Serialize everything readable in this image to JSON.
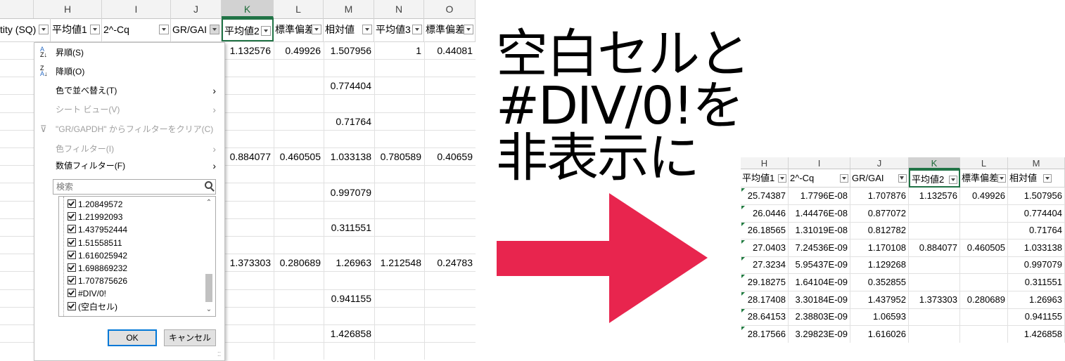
{
  "left_sheet": {
    "columns": [
      "H",
      "I",
      "J",
      "K",
      "L",
      "M",
      "N",
      "O"
    ],
    "filter_headers": [
      "tity (SQ)",
      "平均値1",
      "2^-Cq",
      "GR/GAI",
      "平均値2",
      "標準偏差",
      "相対値",
      "平均値3",
      "標準偏差"
    ],
    "rows": [
      [
        "",
        "",
        "",
        "1.132576",
        "0.49926",
        "1.507956",
        "1",
        "0.44081"
      ],
      [
        "",
        "",
        "",
        "",
        "",
        "",
        "",
        ""
      ],
      [
        "",
        "",
        "",
        "",
        "",
        "0.774404",
        "",
        ""
      ],
      [
        "",
        "",
        "",
        "",
        "",
        "",
        "",
        ""
      ],
      [
        "",
        "",
        "",
        "",
        "",
        "0.71764",
        "",
        ""
      ],
      [
        "",
        "",
        "",
        "",
        "",
        "",
        "",
        ""
      ],
      [
        "",
        "",
        "",
        "0.884077",
        "0.460505",
        "1.033138",
        "0.780589",
        "0.40659"
      ],
      [
        "",
        "",
        "",
        "",
        "",
        "",
        "",
        ""
      ],
      [
        "",
        "",
        "",
        "",
        "",
        "0.997079",
        "",
        ""
      ],
      [
        "",
        "",
        "",
        "",
        "",
        "",
        "",
        ""
      ],
      [
        "",
        "",
        "",
        "",
        "",
        "0.311551",
        "",
        ""
      ],
      [
        "",
        "",
        "",
        "",
        "",
        "",
        "",
        ""
      ],
      [
        "",
        "",
        "",
        "1.373303",
        "0.280689",
        "1.26963",
        "1.212548",
        "0.24783"
      ],
      [
        "",
        "",
        "",
        "",
        "",
        "",
        "",
        ""
      ],
      [
        "",
        "",
        "",
        "",
        "",
        "0.941155",
        "",
        ""
      ],
      [
        "",
        "",
        "",
        "",
        "",
        "",
        "",
        ""
      ],
      [
        "",
        "",
        "",
        "",
        "",
        "1.426858",
        "",
        ""
      ],
      [
        "",
        "",
        "",
        "",
        "",
        "",
        "",
        ""
      ]
    ]
  },
  "dropdown": {
    "sort_asc": "昇順(S)",
    "sort_desc": "降順(O)",
    "sort_by_color": "色で並べ替え(T)",
    "sheet_view": "シート ビュー(V)",
    "clear_filter": "\"GR/GAPDH\" からフィルターをクリア(C)",
    "color_filter": "色フィルター(I)",
    "number_filter": "数値フィルター(F)",
    "search_placeholder": "検索",
    "checklist": [
      "1.20849572",
      "1.21992093",
      "1.437952444",
      "1.51558511",
      "1.616025942",
      "1.698869232",
      "1.707875626",
      "#DIV/0!",
      "(空白セル)"
    ],
    "ok_label": "OK",
    "cancel_label": "キャンセル"
  },
  "caption": {
    "line1": "空白セルと",
    "line2": "#DIV/0!を",
    "line3": "非表示に"
  },
  "arrow_color": "#e8254e",
  "right_sheet": {
    "columns": [
      "H",
      "I",
      "J",
      "K",
      "L",
      "M"
    ],
    "filter_headers": [
      "平均値1",
      "2^-Cq",
      "GR/GAI",
      "平均値2",
      "標準偏差",
      "相対値"
    ],
    "rows": [
      [
        "25.74387",
        "1.7796E-08",
        "1.707876",
        "1.132576",
        "0.49926",
        "1.507956"
      ],
      [
        "26.0446",
        "1.44476E-08",
        "0.877072",
        "",
        "",
        "0.774404"
      ],
      [
        "26.18565",
        "1.31019E-08",
        "0.812782",
        "",
        "",
        "0.71764"
      ],
      [
        "27.0403",
        "7.24536E-09",
        "1.170108",
        "0.884077",
        "0.460505",
        "1.033138"
      ],
      [
        "27.3234",
        "5.95437E-09",
        "1.129268",
        "",
        "",
        "0.997079"
      ],
      [
        "29.18275",
        "1.64104E-09",
        "0.352855",
        "",
        "",
        "0.311551"
      ],
      [
        "28.17408",
        "3.30184E-09",
        "1.437952",
        "1.373303",
        "0.280689",
        "1.26963"
      ],
      [
        "28.64153",
        "2.38803E-09",
        "1.06593",
        "",
        "",
        "0.941155"
      ],
      [
        "28.17566",
        "3.29823E-09",
        "1.616026",
        "",
        "",
        "1.426858"
      ]
    ]
  }
}
